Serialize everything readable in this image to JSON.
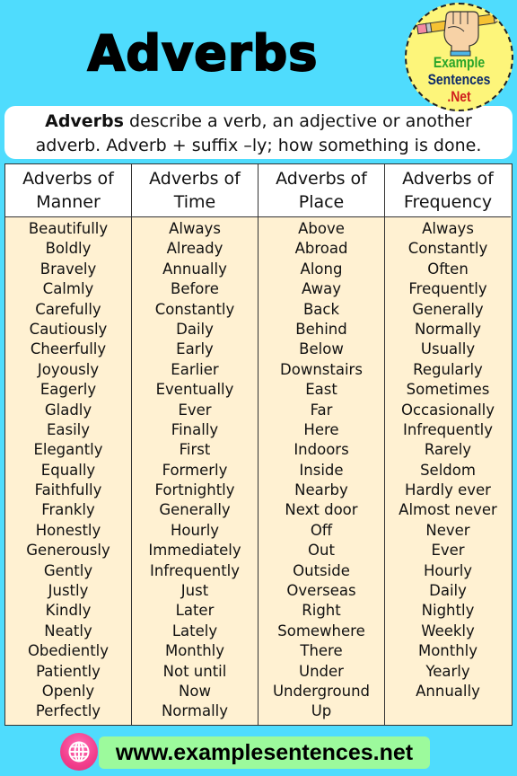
{
  "header": {
    "title": "Adverbs"
  },
  "logo": {
    "line1": "Example",
    "line2": "Sentences",
    "line3": ".Net",
    "icon": "hand-holding-pencil-icon",
    "colors": {
      "line1": "#2aa52a",
      "line2": "#0d2a6a",
      "line3": "#d0201e",
      "badge": "#fdf57a"
    }
  },
  "description": {
    "bold": "Adverbs",
    "line1_rest": " describe a verb, an adjective or another",
    "line2": "adverb. Adverb + suffix –ly; how something is done."
  },
  "table": {
    "columns": [
      {
        "header_line1": "Adverbs of",
        "header_line2": "Manner",
        "items": [
          "Beautifully",
          "Boldly",
          "Bravely",
          "Calmly",
          "Carefully",
          "Cautiously",
          "Cheerfully",
          "Joyously",
          "Eagerly",
          "Gladly",
          "Easily",
          "Elegantly",
          "Equally",
          "Faithfully",
          "Frankly",
          "Honestly",
          "Generously",
          "Gently",
          "Justly",
          "Kindly",
          "Neatly",
          "Obediently",
          "Patiently",
          "Openly",
          "Perfectly"
        ]
      },
      {
        "header_line1": "Adverbs of",
        "header_line2": "Time",
        "items": [
          "Always",
          "Already",
          "Annually",
          "Before",
          "Constantly",
          "Daily",
          "Early",
          "Earlier",
          "Eventually",
          "Ever",
          "Finally",
          "First",
          "Formerly",
          "Fortnightly",
          "Generally",
          "Hourly",
          "Immediately",
          "Infrequently",
          "Just",
          "Later",
          "Lately",
          "Monthly",
          "Not until",
          "Now",
          "Normally"
        ]
      },
      {
        "header_line1": "Adverbs of",
        "header_line2": "Place",
        "items": [
          "Above",
          "Abroad",
          "Along",
          "Away",
          "Back",
          "Behind",
          "Below",
          "Downstairs",
          "East",
          "Far",
          "Here",
          "Indoors",
          "Inside",
          "Nearby",
          "Next door",
          "Off",
          "Out",
          "Outside",
          "Overseas",
          "Right",
          "Somewhere",
          "There",
          "Under",
          "Underground",
          "Up"
        ]
      },
      {
        "header_line1": "Adverbs of",
        "header_line2": "Frequency",
        "items": [
          "Always",
          "Constantly",
          "Often",
          "Frequently",
          "Generally",
          "Normally",
          "Usually",
          "Regularly",
          "Sometimes",
          "Occasionally",
          "Infrequently",
          "Rarely",
          "Seldom",
          "Hardly ever",
          "Almost never",
          "Never",
          "Ever",
          "Hourly",
          "Daily",
          "Nightly",
          "Weekly",
          "Monthly",
          "Yearly",
          "Annually"
        ]
      }
    ]
  },
  "footer": {
    "icon": "globe-icon",
    "url": "www.examplesentences.net"
  },
  "colors": {
    "background": "#4fdcfd",
    "table_body": "#fff1d2",
    "footer_pill": "#9cfa9c",
    "globe_badge": "#f23e8c"
  }
}
